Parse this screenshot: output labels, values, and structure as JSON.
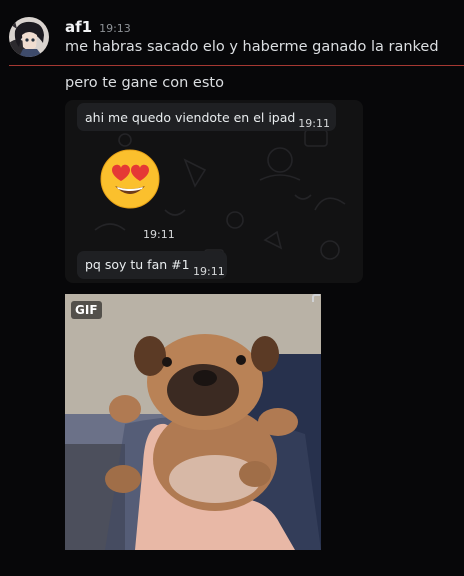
{
  "message": {
    "author": "af1",
    "time": "19:13",
    "lines": [
      "me habras sacado elo y haberme ganado la ranked",
      "pero te gane con esto"
    ]
  },
  "embedded_screenshot": {
    "bubbles": [
      {
        "text": "ahi me quedo viendote en el ipad",
        "time": "19:11"
      },
      {
        "text": "",
        "time": "19:11",
        "emoji": "heart-eyes-emoji"
      },
      {
        "text": "pq soy tu fan #1",
        "time": "19:11"
      }
    ]
  },
  "gif": {
    "badge": "GIF",
    "subject": "puppy held in hand"
  },
  "colors": {
    "background": "#070709",
    "new_messages_divider": "#c1413a",
    "bubble": "#1f2023"
  }
}
